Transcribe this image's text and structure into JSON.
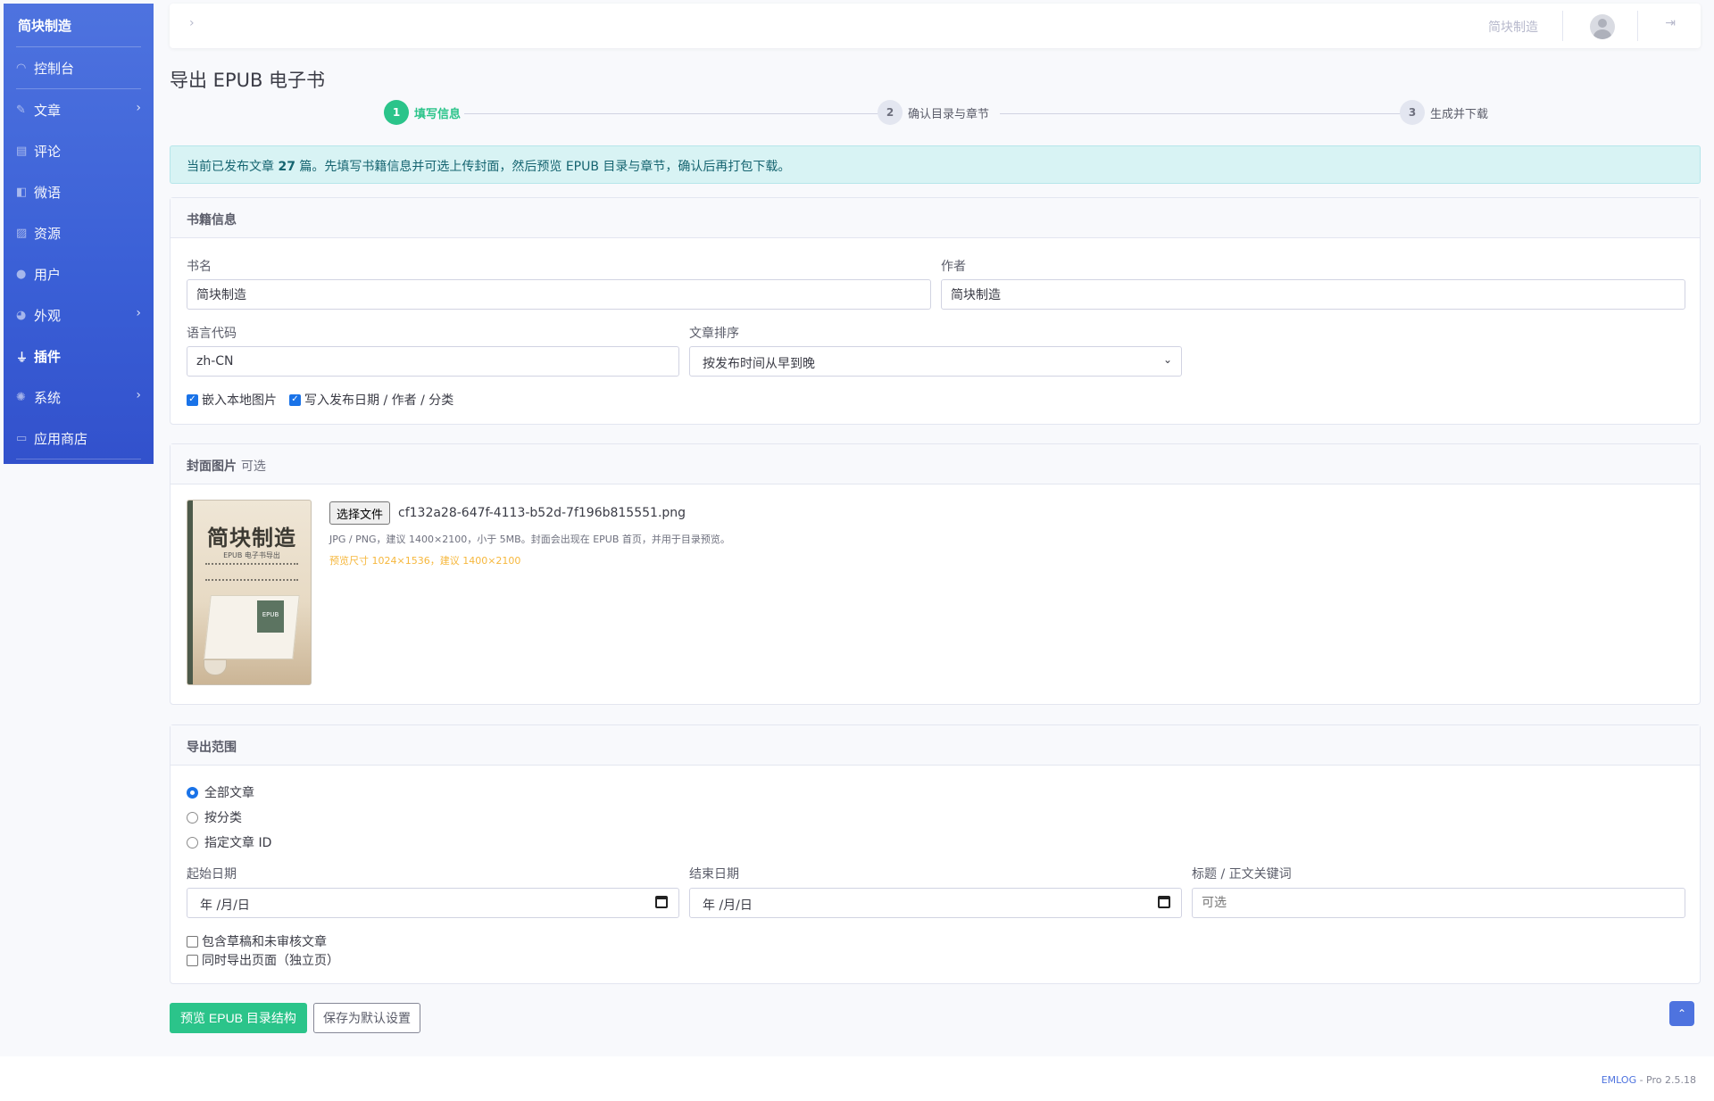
{
  "sidebar": {
    "brand": "简块制造",
    "items": [
      {
        "label": "控制台",
        "icon": "tachometer-icon",
        "glyph": "◠"
      },
      {
        "label": "文章",
        "icon": "pencil-icon",
        "glyph": "✎"
      },
      {
        "label": "评论",
        "icon": "comment-icon",
        "glyph": "▤"
      },
      {
        "label": "微语",
        "icon": "note-icon",
        "glyph": "◧"
      },
      {
        "label": "资源",
        "icon": "image-icon",
        "glyph": "▨"
      },
      {
        "label": "用户",
        "icon": "user-icon",
        "glyph": "●"
      },
      {
        "label": "外观",
        "icon": "palette-icon",
        "glyph": "◕"
      },
      {
        "label": "插件",
        "icon": "plug-icon",
        "glyph": "⏚"
      },
      {
        "label": "系统",
        "icon": "gear-icon",
        "glyph": "✺"
      },
      {
        "label": "应用商店",
        "icon": "cart-icon",
        "glyph": "▭"
      }
    ],
    "chevron": "›"
  },
  "topbar": {
    "toggle": "›",
    "site_name": "简块制造",
    "logout": "⇥"
  },
  "page": {
    "title": "导出 EPUB 电子书"
  },
  "stepper": {
    "steps": [
      {
        "num": "1",
        "label": "填写信息"
      },
      {
        "num": "2",
        "label": "确认目录与章节"
      },
      {
        "num": "3",
        "label": "生成并下载"
      }
    ]
  },
  "alert": {
    "prefix": "当前已发布文章 ",
    "count": "27",
    "suffix": " 篇。先填写书籍信息并可选上传封面，然后预览 EPUB 目录与章节，确认后再打包下载。"
  },
  "book_info": {
    "header": "书籍信息",
    "title_label": "书名",
    "title_value": "简块制造",
    "author_label": "作者",
    "author_value": "简块制造",
    "lang_label": "语言代码",
    "lang_value": "zh-CN",
    "sort_label": "文章排序",
    "sort_value": "按发布时间从早到晚",
    "embed_images": "嵌入本地图片",
    "write_meta": "写入发布日期 / 作者 / 分类"
  },
  "cover": {
    "header": "封面图片",
    "header_note": "可选",
    "choose_file": "选择文件",
    "file_name": "cf132a28-647f-4113-b52d-7f196b815551.png",
    "help": "JPG / PNG，建议 1400×2100，小于 5MB。封面会出现在 EPUB 首页，并用于目录预览。",
    "warn": "预览尺寸 1024×1536，建议 1400×2100",
    "image_title": "简块制造",
    "image_subtitle": "EPUB 电子书导出",
    "image_badge": "EPUB"
  },
  "export_range": {
    "header": "导出范围",
    "options": [
      "全部文章",
      "按分类",
      "指定文章 ID"
    ],
    "start_label": "起始日期",
    "start_placeholder": "年 /月/日",
    "end_label": "结束日期",
    "end_placeholder": "年 /月/日",
    "keyword_label": "标题 / 正文关键词",
    "keyword_placeholder": "可选",
    "include_drafts": "包含草稿和未审核文章",
    "export_pages": "同时导出页面（独立页）"
  },
  "actions": {
    "preview": "预览 EPUB 目录结构",
    "save_default": "保存为默认设置",
    "to_top": "⌃"
  },
  "footer": {
    "brand": "EMLOG",
    "version": " - Pro 2.5.18"
  }
}
